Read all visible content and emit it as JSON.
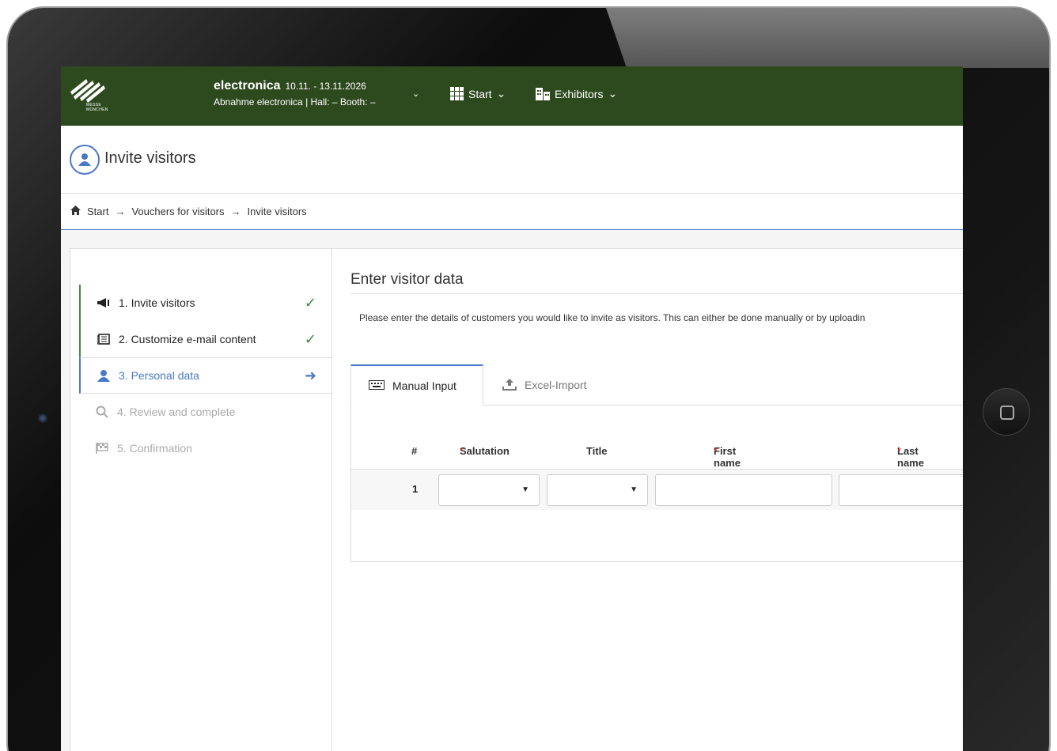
{
  "header": {
    "logo_text": "MESSE MÜNCHEN",
    "event_name": "electronica",
    "event_dates": "10.11. - 13.11.2026",
    "event_sub": "Abnahme electronica | Hall: – Booth: –",
    "nav": [
      {
        "label": "Start",
        "icon": "grid-icon"
      },
      {
        "label": "Exhibitors",
        "icon": "building-icon"
      }
    ],
    "caret": "⌄"
  },
  "page": {
    "title": "Invite visitors"
  },
  "breadcrumb": {
    "items": [
      "Start",
      "Vouchers for visitors",
      "Invite visitors"
    ],
    "separator": "→"
  },
  "steps": [
    {
      "label": "1. Invite visitors",
      "icon": "megaphone-icon",
      "status": "done",
      "mark": "✓"
    },
    {
      "label": "2. Customize e-mail content",
      "icon": "newspaper-icon",
      "status": "done",
      "mark": "✓"
    },
    {
      "label": "3. Personal data",
      "icon": "users-icon",
      "status": "active",
      "mark": "➜"
    },
    {
      "label": "4. Review and complete",
      "icon": "search-icon",
      "status": "pending",
      "mark": ""
    },
    {
      "label": "5. Confirmation",
      "icon": "flag-icon",
      "status": "pending",
      "mark": ""
    }
  ],
  "main": {
    "section_title": "Enter visitor data",
    "description": "Please enter the details of customers you would like to invite as visitors. This can either be done manually or by uploadin",
    "tabs": [
      {
        "label": "Manual Input",
        "icon": "keyboard-icon"
      },
      {
        "label": "Excel-Import",
        "icon": "upload-icon"
      }
    ],
    "table": {
      "columns": [
        {
          "label": "#",
          "required": false
        },
        {
          "label": "Salutation",
          "required": true
        },
        {
          "label": "Title",
          "required": false
        },
        {
          "label": "First name",
          "required": true
        },
        {
          "label": "Last name",
          "required": true
        }
      ],
      "required_marker": "*",
      "rows": [
        {
          "num": "1",
          "salutation": "",
          "title": "",
          "first_name": "",
          "last_name": ""
        }
      ]
    }
  },
  "colors": {
    "topbar": "#2d4a1e",
    "accent": "#4a78c8",
    "done": "#3a8a3a",
    "required": "#d33333"
  }
}
